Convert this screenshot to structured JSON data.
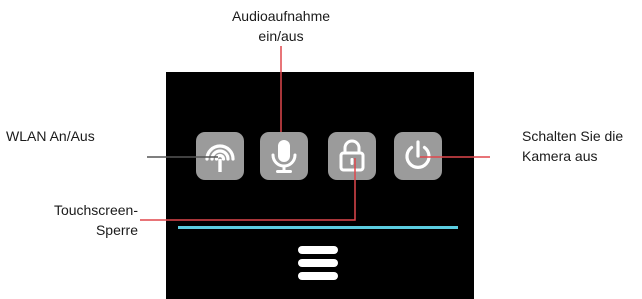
{
  "callouts": {
    "audio": {
      "line1": "Audioaufnahme",
      "line2": "ein/aus"
    },
    "wlan": {
      "line1": "WLAN An/Aus"
    },
    "power": {
      "line1": "Schalten Sie die",
      "line2": "Kamera aus"
    },
    "lock": {
      "line1": "Touchscreen-",
      "line2": "Sperre"
    }
  },
  "icons": {
    "wlan": "wifi-signal-icon",
    "audio": "microphone-icon",
    "lock": "padlock-icon",
    "power": "power-icon",
    "menu": "hamburger-menu-icon"
  },
  "colors": {
    "screen_background": "#000000",
    "icon_button": "#9b9b9b",
    "accent_bar": "#5bcde0",
    "leader_line_gray": "#555555",
    "leader_line_red": "#e0474c"
  }
}
